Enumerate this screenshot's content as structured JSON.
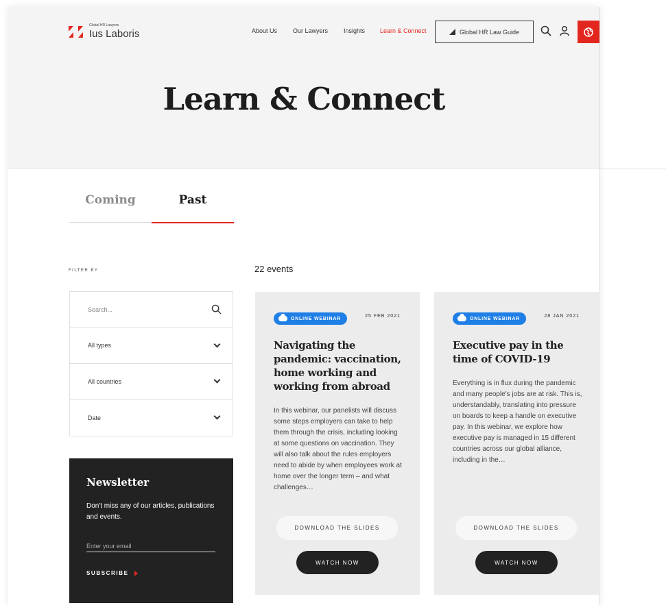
{
  "header": {
    "logo_tagline": "Global HR Lawyers",
    "logo_name": "Ius Laboris",
    "nav": [
      {
        "label": "About Us"
      },
      {
        "label": "Our Lawyers"
      },
      {
        "label": "Insights"
      },
      {
        "label": "Learn & Connect",
        "active": true
      }
    ],
    "guide_button": "Global HR Law Guide",
    "accent_color": "#e3271e"
  },
  "hero": {
    "title": "Learn & Connect"
  },
  "tabs": [
    {
      "label": "Coming"
    },
    {
      "label": "Past",
      "active": true
    }
  ],
  "filters": {
    "label": "FILTER BY",
    "search_placeholder": "Search...",
    "types": "All types",
    "countries": "All countries",
    "date": "Date"
  },
  "newsletter": {
    "title": "Newsletter",
    "text": "Don't miss any of our articles, publications and events.",
    "email_placeholder": "Enter your email",
    "subscribe": "SUBSCRIBE"
  },
  "events": {
    "count": "22 events",
    "badge_color": "#1f7fe6",
    "items": [
      {
        "type": "ONLINE WEBINAR",
        "date": "25 FEB 2021",
        "title": "Navigating the pandemic: vaccination, home working and working from abroad",
        "description": "In this webinar, our panelists will discuss some steps employers can take to help them through the crisis, including looking at some questions on vaccination. They will also talk about the rules employers need to abide by when employees work at home over the longer term – and what challenges…",
        "slides_button": "DOWNLOAD THE SLIDES",
        "watch_button": "WATCH NOW"
      },
      {
        "type": "ONLINE WEBINAR",
        "date": "28 JAN 2021",
        "title": "Executive pay in the time of COVID-19",
        "description": "Everything is in flux during the pandemic and many people's jobs are at risk. This is, understandably, translating into pressure on boards to keep a handle on executive pay. In this webinar, we explore how executive pay is managed in 15 different countries across our global alliance, including in the…",
        "slides_button": "DOWNLOAD THE SLIDES",
        "watch_button": "WATCH NOW"
      }
    ]
  }
}
